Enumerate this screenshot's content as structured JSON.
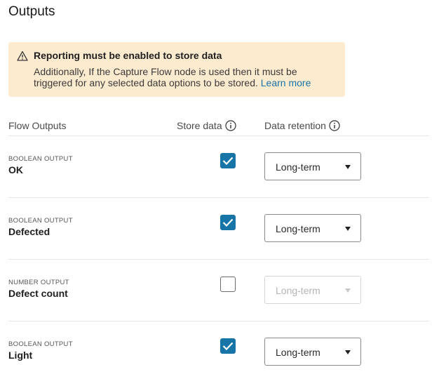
{
  "page": {
    "title": "Outputs"
  },
  "alert": {
    "title": "Reporting must be enabled to store data",
    "body": "Additionally, If the Capture Flow node is used then it must be triggered for any selected data options to be stored.",
    "link": "Learn more",
    "icon": "warning-icon"
  },
  "table": {
    "headers": {
      "outputs": "Flow Outputs",
      "store": "Store data",
      "retention": "Data retention"
    },
    "rows": [
      {
        "type": "BOOLEAN OUTPUT",
        "name": "OK",
        "store": true,
        "retention": "Long-term",
        "disabled": false
      },
      {
        "type": "BOOLEAN OUTPUT",
        "name": "Defected",
        "store": true,
        "retention": "Long-term",
        "disabled": false
      },
      {
        "type": "NUMBER OUTPUT",
        "name": "Defect count",
        "store": false,
        "retention": "Long-term",
        "disabled": true
      },
      {
        "type": "BOOLEAN OUTPUT",
        "name": "Light",
        "store": true,
        "retention": "Long-term",
        "disabled": false
      }
    ]
  },
  "colors": {
    "accent": "#1675a6",
    "alert_bg": "#fdebcf"
  }
}
